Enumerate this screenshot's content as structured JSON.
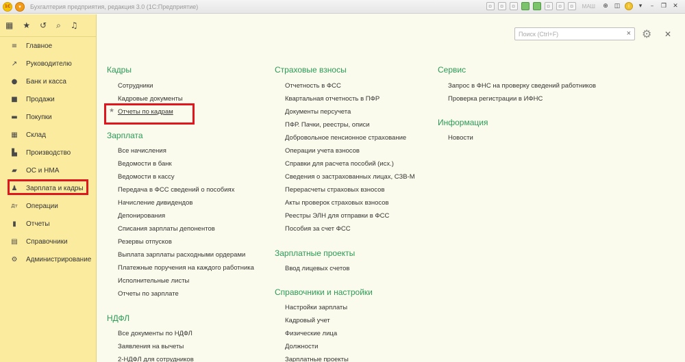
{
  "titlebar": {
    "logo": "1С",
    "app_title": "Бухгалтерия предприятия, редакция 3.0  (1С:Предприятие)",
    "mid_text": "МАШ"
  },
  "sidebar": {
    "items": [
      {
        "label": "Главное",
        "icon": "menu-icon"
      },
      {
        "label": "Руководителю",
        "icon": "chart-trend-icon"
      },
      {
        "label": "Банк и касса",
        "icon": "coin-icon"
      },
      {
        "label": "Продажи",
        "icon": "briefcase-icon"
      },
      {
        "label": "Покупки",
        "icon": "cart-icon"
      },
      {
        "label": "Склад",
        "icon": "warehouse-icon"
      },
      {
        "label": "Производство",
        "icon": "factory-icon"
      },
      {
        "label": "ОС и НМА",
        "icon": "truck-icon"
      },
      {
        "label": "Зарплата и кадры",
        "icon": "person-icon"
      },
      {
        "label": "Операции",
        "icon": "operations-icon"
      },
      {
        "label": "Отчеты",
        "icon": "bar-chart-icon"
      },
      {
        "label": "Справочники",
        "icon": "books-icon"
      },
      {
        "label": "Администрирование",
        "icon": "gear-icon"
      }
    ]
  },
  "search": {
    "placeholder": "Поиск (Ctrl+F)",
    "clear": "×"
  },
  "columns": {
    "col1": {
      "kadry": {
        "title": "Кадры",
        "links": [
          "Сотрудники",
          "Кадровые документы",
          "Отчеты по кадрам"
        ]
      },
      "zarplata": {
        "title": "Зарплата",
        "links": [
          "Все начисления",
          "Ведомости в банк",
          "Ведомости в кассу",
          "Передача в ФСС сведений о пособиях",
          "Начисление дивидендов",
          "Депонирования",
          "Списания зарплаты депонентов",
          "Резервы отпусков",
          "Выплата зарплаты расходными ордерами",
          "Платежные поручения на каждого работника",
          "Исполнительные листы",
          "Отчеты по зарплате"
        ]
      },
      "ndfl": {
        "title": "НДФЛ",
        "links": [
          "Все документы по НДФЛ",
          "Заявления на вычеты",
          "2-НДФЛ для сотрудников"
        ]
      }
    },
    "col2": {
      "strah": {
        "title": "Страховые взносы",
        "links": [
          "Отчетность в ФСС",
          "Квартальная отчетность в ПФР",
          "Документы персучета",
          "ПФР. Пачки, реестры, описи",
          "Добровольное пенсионное страхование",
          "Операции учета взносов",
          "Справки для расчета пособий (исх.)",
          "Сведения о застрахованных лицах, СЗВ-М",
          "Перерасчеты страховых взносов",
          "Акты проверок страховых взносов",
          "Реестры ЭЛН для отправки в ФСС",
          "Пособия за счет ФСС"
        ]
      },
      "zp_projects": {
        "title": "Зарплатные проекты",
        "links": [
          "Ввод лицевых счетов"
        ]
      },
      "sprav": {
        "title": "Справочники и настройки",
        "links": [
          "Настройки зарплаты",
          "Кадровый учет",
          "Физические лица",
          "Должности",
          "Зарплатные проекты"
        ]
      }
    },
    "col3": {
      "service": {
        "title": "Сервис",
        "links": [
          "Запрос в ФНС на проверку сведений работников",
          "Проверка регистрации в ИФНС"
        ]
      },
      "info": {
        "title": "Информация",
        "links": [
          "Новости"
        ]
      }
    }
  }
}
